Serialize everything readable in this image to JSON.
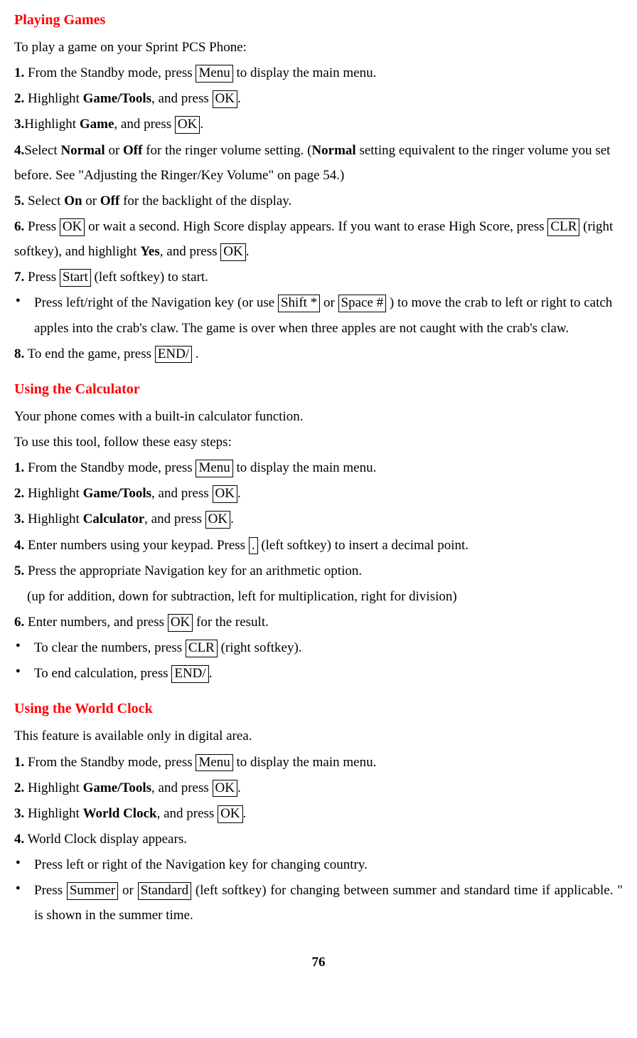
{
  "sec1": {
    "heading": "Playing Games",
    "intro": "To play a game on your Sprint PCS Phone:",
    "s1a": "1.",
    "s1b": " From the Standby mode, press ",
    "s1key": "Menu",
    "s1c": " to display the main menu.",
    "s2a": "2.",
    "s2b": " Highlight ",
    "s2bold": "Game/Tools",
    "s2c": ", and press ",
    "s2key": "OK",
    "s2d": ".",
    "s3a": "3.",
    "s3b": "Highlight ",
    "s3bold": "Game",
    "s3c": ", and press ",
    "s3key": "OK",
    "s3d": ".",
    "s4a": "4.",
    "s4b": "Select ",
    "s4bold1": "Normal",
    "s4c": " or ",
    "s4bold2": "Off",
    "s4d": " for the ringer volume setting. (",
    "s4bold3": "Normal",
    "s4e": " setting equivalent to the ringer volume you set before. See \"Adjusting the Ringer/Key Volume\" on page 54.)",
    "s5a": "5.",
    "s5b": " Select ",
    "s5bold1": "On",
    "s5c": " or ",
    "s5bold2": "Off",
    "s5d": " for the backlight of the display.",
    "s6a": "6.",
    "s6b": " Press ",
    "s6key1": "OK",
    "s6c": " or wait a second. High Score display appears. If you want to erase High Score, press ",
    "s6key2": "CLR",
    "s6d": " (right softkey), and highlight ",
    "s6bold": "Yes",
    "s6e": ", and press ",
    "s6key3": "OK",
    "s6f": ".",
    "s7a": "7.",
    "s7b": " Press ",
    "s7key": "Start",
    "s7c": " (left softkey) to start.",
    "b1a": "Press left/right of the Navigation key (or use ",
    "b1key1": "Shift *",
    "b1b": " or ",
    "b1key2": "Space #",
    "b1c": " ) to move the crab to left or right to catch apples into the crab's claw. The game is over when three apples are not caught with the crab's claw.",
    "s8a": "8.",
    "s8b": " To end the game, press ",
    "s8key": "END/",
    "s8c": " ."
  },
  "sec2": {
    "heading": "Using the Calculator",
    "intro1": "Your phone comes with a built-in calculator function.",
    "intro2": "To use this tool, follow these easy steps:",
    "s1a": "1.",
    "s1b": " From the Standby mode, press ",
    "s1key": "Menu",
    "s1c": " to display the main menu.",
    "s2a": "2.",
    "s2b": " Highlight ",
    "s2bold": "Game/Tools",
    "s2c": ", and press ",
    "s2key": "OK",
    "s2d": ".",
    "s3a": "3.",
    "s3b": " Highlight ",
    "s3bold": "Calculator",
    "s3c": ", and press ",
    "s3key": "OK",
    "s3d": ".",
    "s4a": "4.",
    "s4b": " Enter numbers using your keypad. Press ",
    "s4key": "  .  ",
    "s4c": " (left  softkey) to insert a decimal point.",
    "s5a": "5.",
    "s5b": " Press the appropriate Navigation key for an arithmetic option.",
    "s5c": "(up for addition, down for subtraction, left for multiplication, right for division)",
    "s6a": "6.",
    "s6b": " Enter numbers, and press ",
    "s6key": "OK",
    "s6c": " for the result.",
    "b1a": "To clear the numbers, press ",
    "b1key": "CLR",
    "b1b": " (right softkey).",
    "b2a": "To end calculation, press ",
    "b2key": "END/ ",
    "b2b": "."
  },
  "sec3": {
    "heading": "Using the World Clock",
    "intro": "This feature is available only in digital area.",
    "s1a": "1.",
    "s1b": " From the Standby mode, press ",
    "s1key": "Menu",
    "s1c": " to display the main menu.",
    "s2a": "2.",
    "s2b": " Highlight ",
    "s2bold": "Game/Tools",
    "s2c": ", and press ",
    "s2key": "OK",
    "s2d": ".",
    "s3a": "3.",
    "s3b": " Highlight ",
    "s3bold": "World Clock",
    "s3c": ", and press ",
    "s3key": "OK",
    "s3d": ".",
    "s4a": "4.",
    "s4b": " World Clock display appears.",
    "b1": "Press left or right of the Navigation key for changing country.",
    "b2a": "Press ",
    "b2key1": "Summer",
    "b2b": " or ",
    "b2key2": "Standard",
    "b2c": " (left softkey) for changing between summer and standard time if applicable. \"     is shown in the summer time."
  },
  "page": "76"
}
